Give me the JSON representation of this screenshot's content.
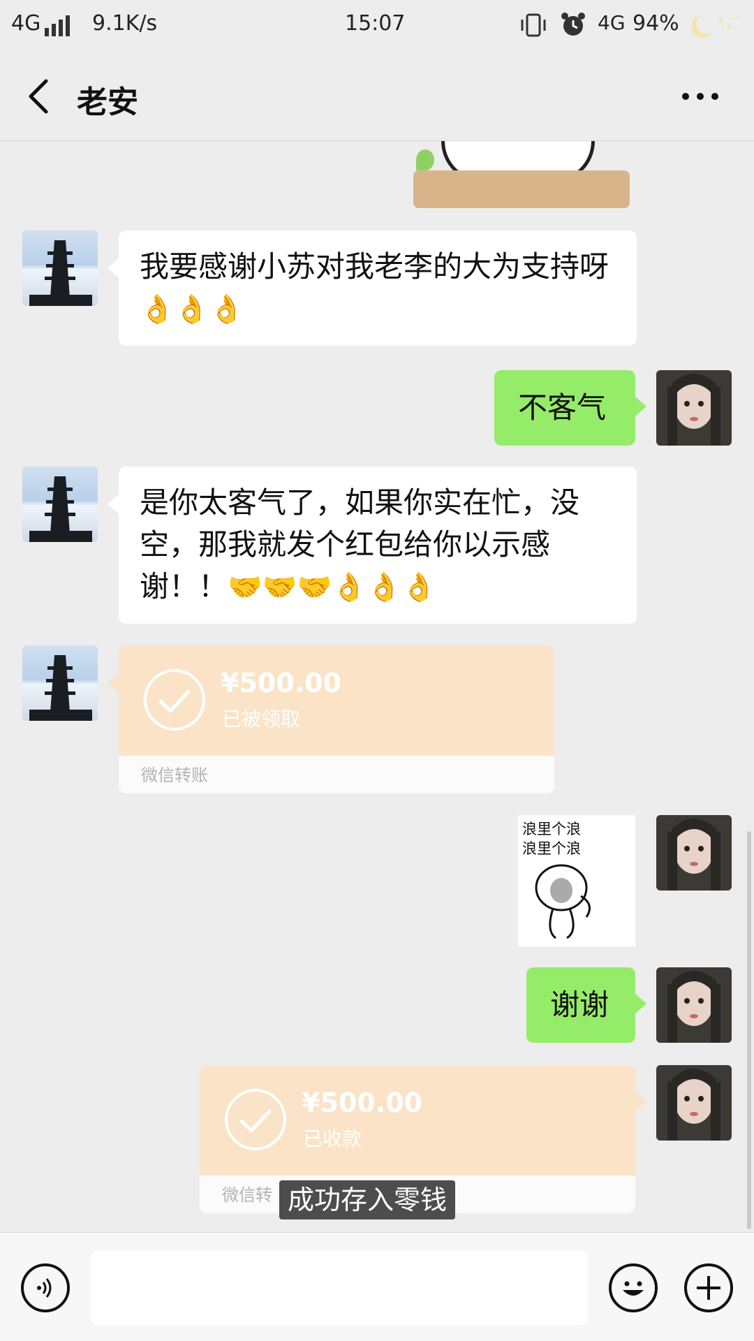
{
  "status_bar": {
    "network": "4G",
    "speed": "9.1K/s",
    "time": "15:07",
    "network_right": "4G",
    "battery": "94%"
  },
  "header": {
    "title": "老安"
  },
  "messages": [
    {
      "side": "left",
      "type": "text",
      "text": "我要感谢小苏对我老李的大为支持呀",
      "emoji": "👌👌👌"
    },
    {
      "side": "right",
      "type": "text",
      "text": "不客气"
    },
    {
      "side": "left",
      "type": "text",
      "text": "是你太客气了，如果你实在忙，没空，那我就发个红包给你以示感谢！！",
      "emoji": "🤝🤝🤝👌👌👌"
    },
    {
      "side": "left",
      "type": "transfer",
      "amount": "¥500.00",
      "status": "已被领取",
      "label": "微信转账"
    },
    {
      "side": "right",
      "type": "sticker",
      "caption_line1": "浪里个浪",
      "caption_line2": "浪里个浪"
    },
    {
      "side": "right",
      "type": "text",
      "text": "谢谢"
    },
    {
      "side": "right",
      "type": "transfer",
      "amount": "¥500.00",
      "status": "已收款",
      "label": "微信转"
    }
  ],
  "toast": "成功存入零钱",
  "input": {
    "placeholder": ""
  },
  "colors": {
    "green_bubble": "#95ec69",
    "transfer": "#fbe3c8",
    "background": "#ededed"
  }
}
